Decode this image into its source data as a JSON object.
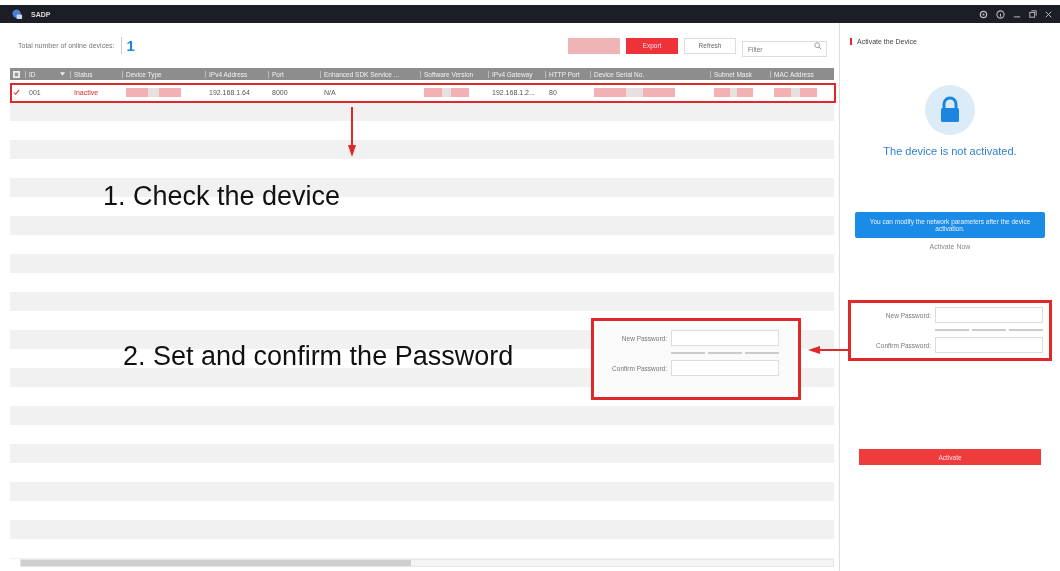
{
  "window": {
    "title": "SADP"
  },
  "toolbar": {
    "total_label": "Total number of online devices:",
    "total_count": "1",
    "buttons": [
      {
        "kind": "faded"
      },
      {
        "kind": "primary",
        "label": "Export"
      },
      {
        "kind": "plain",
        "label": "Refresh"
      }
    ],
    "filter": {
      "placeholder": "Filter"
    }
  },
  "table": {
    "select_all": {
      "checked": true
    },
    "columns": [
      "ID",
      "Status",
      "Device Type",
      "IPv4 Address",
      "Port",
      "Enhanced SDK Service ...",
      "Software Version",
      "IPv4 Gateway",
      "HTTP Port",
      "Device Serial No.",
      "Subnet Mask",
      "MAC Address"
    ],
    "rows": [
      {
        "checked": true,
        "cells": [
          {
            "kind": "text",
            "text": "001"
          },
          {
            "kind": "status",
            "text": "Inactive"
          },
          {
            "kind": "redacted"
          },
          {
            "kind": "text",
            "text": "192.168.1.64"
          },
          {
            "kind": "text",
            "text": "8000"
          },
          {
            "kind": "text",
            "text": "N/A"
          },
          {
            "kind": "redacted"
          },
          {
            "kind": "text",
            "text": "192.168.1.2..."
          },
          {
            "kind": "text",
            "text": "80"
          },
          {
            "kind": "redacted"
          },
          {
            "kind": "redacted"
          },
          {
            "kind": "redacted"
          }
        ]
      }
    ]
  },
  "annotations": {
    "steps": [
      "1. Check the device",
      "2. Set and confirm the Password"
    ],
    "inset": {
      "new_password_label": "New Password:",
      "confirm_password_label": "Confirm Password:"
    }
  },
  "activate_panel": {
    "title": "Activate the Device",
    "status_text": "The device is not activated.",
    "tooltip": "You can modify the network parameters after the device activation.",
    "activate_now": "Activate Now",
    "new_password_label": "New Password:",
    "confirm_password_label": "Confirm Password:",
    "activate_button": "Activate"
  }
}
